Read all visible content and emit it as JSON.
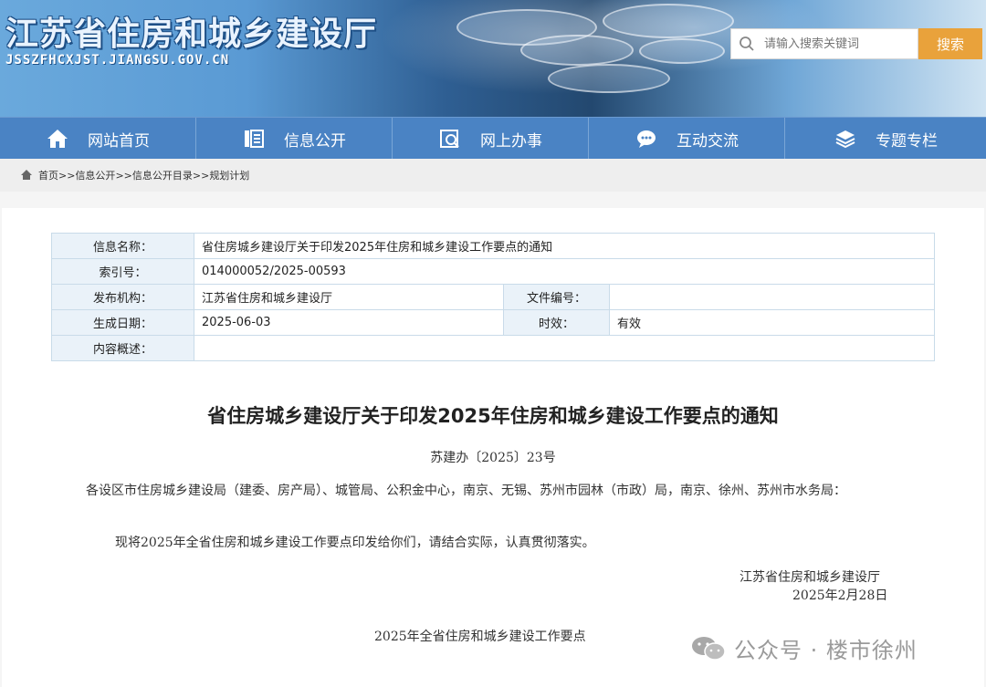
{
  "header": {
    "title": "江苏省住房和城乡建设厅",
    "url_text": "JSSZFHCXJST.JIANGSU.GOV.CN"
  },
  "search": {
    "placeholder": "请输入搜索关键词",
    "button_label": "搜索"
  },
  "nav": {
    "items": [
      {
        "label": "网站首页",
        "icon": "home-icon"
      },
      {
        "label": "信息公开",
        "icon": "document-list-icon"
      },
      {
        "label": "网上办事",
        "icon": "service-icon"
      },
      {
        "label": "互动交流",
        "icon": "chat-icon"
      },
      {
        "label": "专题专栏",
        "icon": "layers-icon"
      }
    ]
  },
  "breadcrumb": {
    "items": [
      "首页",
      "信息公开",
      "信息公开目录",
      "规划计划"
    ],
    "separator": ">>"
  },
  "meta": {
    "name_label": "信息名称：",
    "name_value": "省住房城乡建设厅关于印发2025年住房和城乡建设工作要点的通知",
    "index_label": "索引号：",
    "index_value": "014000052/2025-00593",
    "org_label": "发布机构：",
    "org_value": "江苏省住房和城乡建设厅",
    "docno_label": "文件编号：",
    "docno_value": "",
    "date_label": "生成日期：",
    "date_value": "2025-06-03",
    "validity_label": "时效：",
    "validity_value": "有效",
    "summary_label": "内容概述：",
    "summary_value": ""
  },
  "document": {
    "title": "省住房城乡建设厅关于印发2025年住房和城乡建设工作要点的通知",
    "number": "苏建办〔2025〕23号",
    "addressee": "各设区市住房城乡建设局（建委、房产局）、城管局、公积金中心，南京、无锡、苏州市园林（市政）局，南京、徐州、苏州市水务局：",
    "body": "现将2025年全省住房和城乡建设工作要点印发给你们，请结合实际，认真贯彻落实。",
    "sign_org": "江苏省住房和城乡建设厅",
    "sign_date": "2025年2月28日",
    "attachment_title": "2025年全省住房和城乡建设工作要点"
  },
  "watermark": {
    "text": "公众号 · 楼市徐州"
  },
  "colors": {
    "nav_bg": "#4a83c4",
    "search_button": "#e9a23b",
    "table_label_bg": "#eaf2f9",
    "table_border": "#c9dbe9"
  }
}
